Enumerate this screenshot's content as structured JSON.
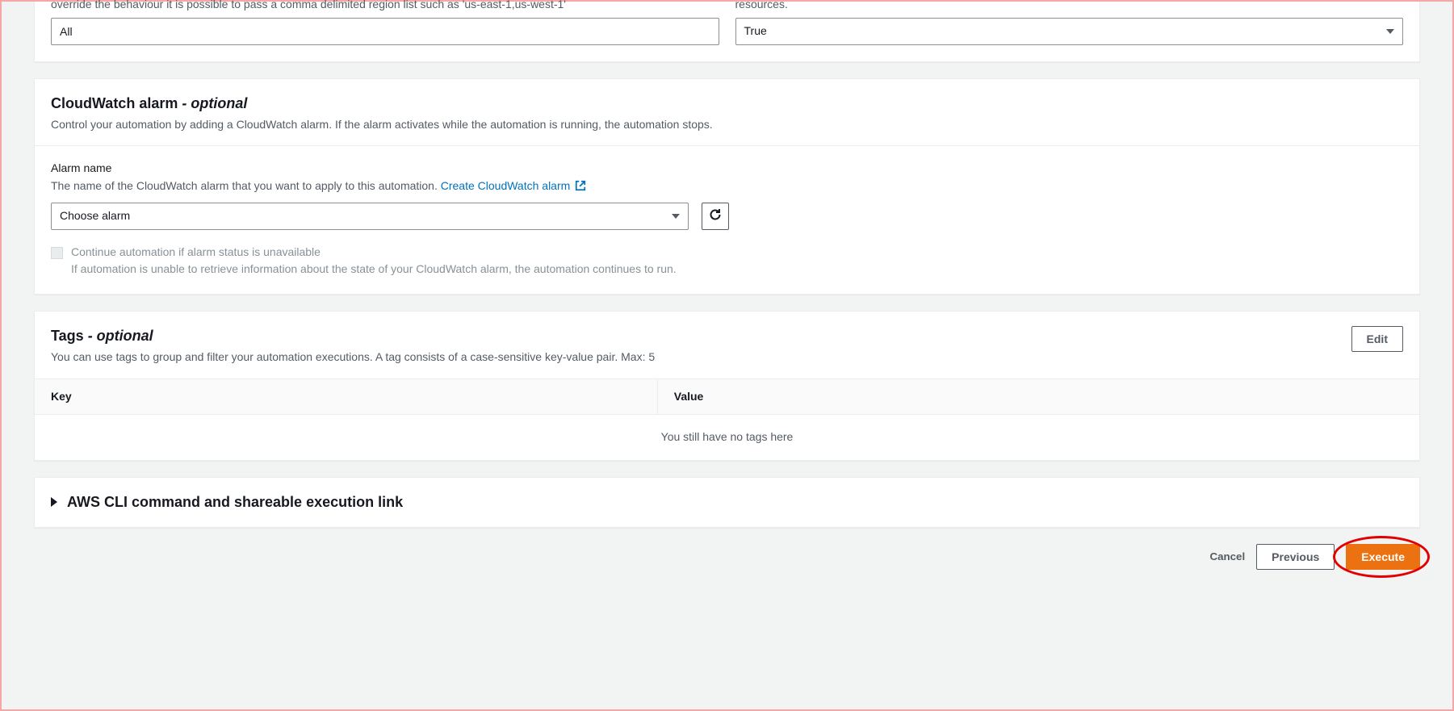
{
  "topSection": {
    "leftHelper": "override the behaviour it is possible to pass a comma delimited region list such as 'us-east-1,us-west-1'",
    "leftValue": "All",
    "rightHelper": "resources.",
    "rightValue": "True"
  },
  "cloudwatch": {
    "title": "CloudWatch alarm",
    "optional": " - optional",
    "desc": "Control your automation by adding a CloudWatch alarm. If the alarm activates while the automation is running, the automation stops.",
    "fieldLabel": "Alarm name",
    "fieldHelp": "The name of the CloudWatch alarm that you want to apply to this automation. ",
    "createLink": "Create CloudWatch alarm",
    "selectPlaceholder": "Choose alarm",
    "checkboxLabel": "Continue automation if alarm status is unavailable",
    "checkboxHelp": "If automation is unable to retrieve information about the state of your CloudWatch alarm, the automation continues to run."
  },
  "tags": {
    "title": "Tags",
    "optional": " - optional",
    "desc": "You can use tags to group and filter your automation executions. A tag consists of a case-sensitive key-value pair. Max: 5",
    "editLabel": "Edit",
    "colKey": "Key",
    "colValue": "Value",
    "empty": "You still have no tags here"
  },
  "cli": {
    "title": "AWS CLI command and shareable execution link"
  },
  "footer": {
    "cancel": "Cancel",
    "previous": "Previous",
    "execute": "Execute"
  }
}
